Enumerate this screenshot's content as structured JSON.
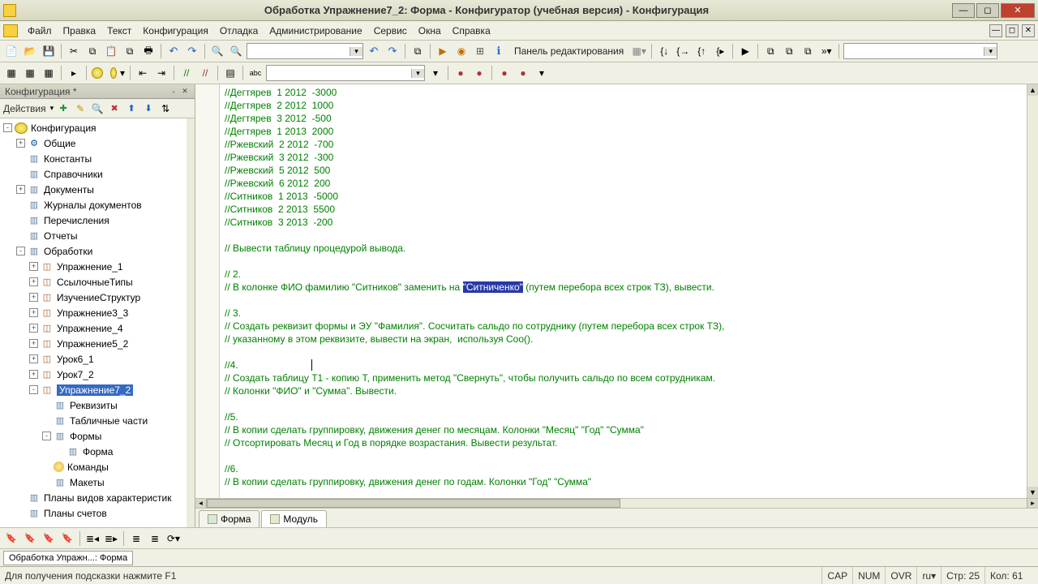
{
  "title": "Обработка Упражнение7_2: Форма - Конфигуратор (учебная версия) - Конфигурация",
  "menu": [
    "Файл",
    "Правка",
    "Текст",
    "Конфигурация",
    "Отладка",
    "Администрирование",
    "Сервис",
    "Окна",
    "Справка"
  ],
  "toolbar1_label": "Панель редактирования",
  "side_title": "Конфигурация *",
  "actions_label": "Действия",
  "tree": [
    {
      "d": 0,
      "t": "-",
      "i": "world",
      "l": "Конфигурация"
    },
    {
      "d": 1,
      "t": "+",
      "i": "gear",
      "l": "Общие"
    },
    {
      "d": 1,
      "t": "",
      "i": "doc",
      "l": "Константы"
    },
    {
      "d": 1,
      "t": "",
      "i": "doc",
      "l": "Справочники"
    },
    {
      "d": 1,
      "t": "+",
      "i": "doc",
      "l": "Документы"
    },
    {
      "d": 1,
      "t": "",
      "i": "doc",
      "l": "Журналы документов"
    },
    {
      "d": 1,
      "t": "",
      "i": "doc",
      "l": "Перечисления"
    },
    {
      "d": 1,
      "t": "",
      "i": "doc",
      "l": "Отчеты"
    },
    {
      "d": 1,
      "t": "-",
      "i": "doc",
      "l": "Обработки"
    },
    {
      "d": 2,
      "t": "+",
      "i": "item",
      "l": "Упражнение_1"
    },
    {
      "d": 2,
      "t": "+",
      "i": "item",
      "l": "СсылочныеТипы"
    },
    {
      "d": 2,
      "t": "+",
      "i": "item",
      "l": "ИзучениеСтруктур"
    },
    {
      "d": 2,
      "t": "+",
      "i": "item",
      "l": "Упражнение3_3"
    },
    {
      "d": 2,
      "t": "+",
      "i": "item",
      "l": "Упражнение_4"
    },
    {
      "d": 2,
      "t": "+",
      "i": "item",
      "l": "Упражнение5_2"
    },
    {
      "d": 2,
      "t": "+",
      "i": "item",
      "l": "Урок6_1"
    },
    {
      "d": 2,
      "t": "+",
      "i": "item",
      "l": "Урок7_2"
    },
    {
      "d": 2,
      "t": "-",
      "i": "item",
      "l": "Упражнение7_2",
      "sel": true
    },
    {
      "d": 3,
      "t": "",
      "i": "doc",
      "l": "Реквизиты"
    },
    {
      "d": 3,
      "t": "",
      "i": "doc",
      "l": "Табличные части"
    },
    {
      "d": 3,
      "t": "-",
      "i": "doc",
      "l": "Формы"
    },
    {
      "d": 4,
      "t": "",
      "i": "doc",
      "l": "Форма"
    },
    {
      "d": 3,
      "t": "",
      "i": "cmd",
      "l": "Команды"
    },
    {
      "d": 3,
      "t": "",
      "i": "doc",
      "l": "Макеты"
    },
    {
      "d": 1,
      "t": "",
      "i": "doc",
      "l": "Планы видов характеристик"
    },
    {
      "d": 1,
      "t": "",
      "i": "doc",
      "l": "Планы счетов"
    }
  ],
  "code": [
    {
      "txt": "//Дегтярев  1 2012  -3000",
      "c": true
    },
    {
      "txt": "//Дегтярев  2 2012  1000",
      "c": true
    },
    {
      "txt": "//Дегтярев  3 2012  -500",
      "c": true
    },
    {
      "txt": "//Дегтярев  1 2013  2000",
      "c": true
    },
    {
      "txt": "//Ржевский  2 2012  -700",
      "c": true
    },
    {
      "txt": "//Ржевский  3 2012  -300",
      "c": true
    },
    {
      "txt": "//Ржевский  5 2012  500",
      "c": true
    },
    {
      "txt": "//Ржевский  6 2012  200",
      "c": true
    },
    {
      "txt": "//Ситников  1 2013  -5000",
      "c": true
    },
    {
      "txt": "//Ситников  2 2013  5500",
      "c": true
    },
    {
      "txt": "//Ситников  3 2013  -200",
      "c": true
    },
    {
      "txt": ""
    },
    {
      "txt": "// Вывести таблицу процедурой вывода.",
      "c": true
    },
    {
      "txt": ""
    },
    {
      "txt": "// 2.",
      "c": true
    },
    {
      "pre": "// В колонке ФИО фамилию \"Ситников\" заменить на ",
      "hl": "\"Ситниченко\"",
      "post": " (путем перебора всех строк ТЗ), вывести.",
      "c": true
    },
    {
      "txt": ""
    },
    {
      "txt": "// 3.",
      "c": true
    },
    {
      "txt": "// Создать реквизит формы и ЭУ \"Фамилия\". Сосчитать сальдо по сотруднику (путем перебора всех строк ТЗ),",
      "c": true
    },
    {
      "txt": "// указанному в этом реквизите, вывести на экран,  используя Соо().",
      "c": true
    },
    {
      "txt": ""
    },
    {
      "txt": "//4.",
      "c": true,
      "caret": true
    },
    {
      "txt": "// Создать таблицу Т1 - копию Т, применить метод \"Свернуть\", чтобы получить сальдо по всем сотрудникам.",
      "c": true
    },
    {
      "txt": "// Колонки \"ФИО\" и \"Сумма\". Вывести.",
      "c": true
    },
    {
      "txt": ""
    },
    {
      "txt": "//5.",
      "c": true
    },
    {
      "txt": "// В копии сделать группировку, движения денег по месяцам. Колонки \"Месяц\" \"Год\" \"Сумма\"",
      "c": true
    },
    {
      "txt": "// Отсортировать Месяц и Год в порядке возрастания. Вывести результат.",
      "c": true
    },
    {
      "txt": ""
    },
    {
      "txt": "//6.",
      "c": true
    },
    {
      "txt": "// В копии сделать группировку, движения денег по годам. Колонки \"Год\" \"Сумма\"",
      "c": true
    }
  ],
  "tabs": [
    {
      "l": "Форма",
      "a": false
    },
    {
      "l": "Модуль",
      "a": true
    }
  ],
  "doctab": "Обработка Упражн...: Форма",
  "status_hint": "Для получения подсказки нажмите F1",
  "status": {
    "cap": "CAP",
    "num": "NUM",
    "ovr": "OVR",
    "lang": "ru",
    "line": "Стр: 25",
    "col": "Кол: 61"
  }
}
